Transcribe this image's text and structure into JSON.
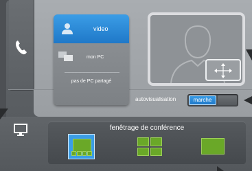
{
  "sources": {
    "video_label": "video",
    "pc_label": "mon PC",
    "none_label": "pas de PC partagé"
  },
  "self_view": {
    "label": "autovisualisation",
    "toggle_value": "marche"
  },
  "conference": {
    "title": "fenêtrage de conférence"
  },
  "icons": [
    "phone-icon",
    "monitor-icon",
    "user-icon",
    "pc-icon",
    "move-icon"
  ],
  "colors": {
    "accent": "#1f78c8",
    "layout_green": "#6aa828"
  }
}
